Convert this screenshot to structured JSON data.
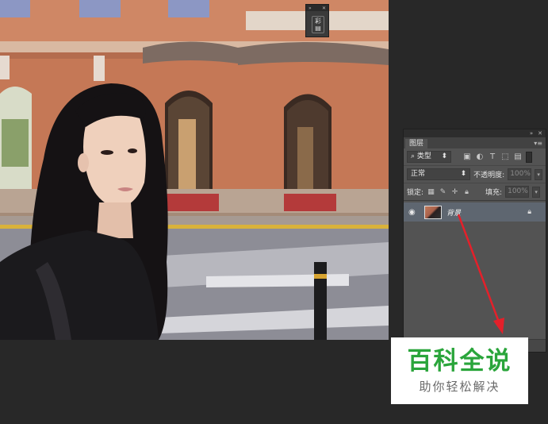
{
  "mini_panel": {
    "collapse_icon": "double-chevron-icon",
    "close_icon": "close-icon",
    "symbol": "彩",
    "subsymbol": "▤"
  },
  "layers_panel": {
    "tab_label": "图层",
    "filter": {
      "search_symbol": "⌕",
      "kind_label": "类型",
      "icons": [
        "image-filter-icon",
        "adjustment-filter-icon",
        "text-filter-icon",
        "shape-filter-icon",
        "smart-object-filter-icon"
      ]
    },
    "blend_mode": "正常",
    "opacity_label": "不透明度:",
    "opacity_value": "100%",
    "lock_label": "锁定:",
    "fill_label": "填充:",
    "fill_value": "100%",
    "layers": [
      {
        "name": "背景",
        "visible": true,
        "locked": true
      }
    ]
  },
  "watermark": {
    "title": "百科全说",
    "subtitle": "助你轻松解决"
  },
  "colors": {
    "workspace": "#282828",
    "panel": "#535353",
    "selected_layer": "#5e6670",
    "arrow": "#e4202a",
    "watermark_green": "#2aa53b"
  }
}
